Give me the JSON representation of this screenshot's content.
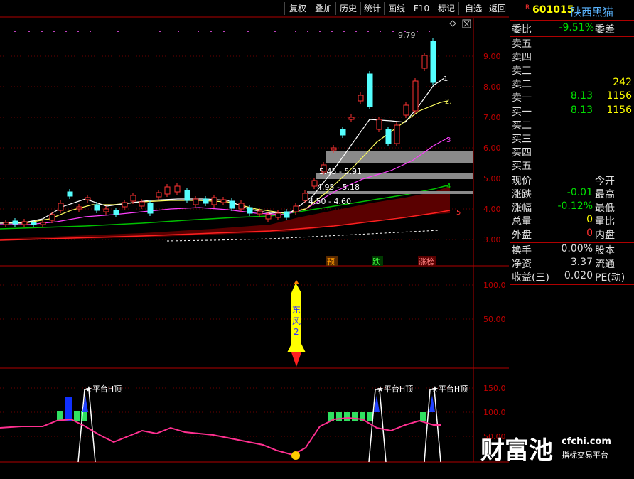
{
  "toolbar": {
    "buttons": [
      "复权",
      "叠加",
      "历史",
      "统计",
      "画线",
      "F10",
      "标记",
      "-自选",
      "返回"
    ],
    "diamond_icon": "diamond-icon",
    "close_icon": "window-close-icon"
  },
  "stock": {
    "r_marker": "R",
    "code": "601015",
    "name": "陕西黑猫"
  },
  "orderbook": {
    "weibi": {
      "label": "委比",
      "value": "-9.51%",
      "label2": "委差"
    },
    "asks": [
      {
        "label": "卖五",
        "price": "",
        "vol": ""
      },
      {
        "label": "卖四",
        "price": "",
        "vol": ""
      },
      {
        "label": "卖三",
        "price": "",
        "vol": ""
      },
      {
        "label": "卖二",
        "price": "",
        "vol": "242"
      },
      {
        "label": "卖一",
        "price": "8.13",
        "vol": "1156"
      }
    ],
    "bids": [
      {
        "label": "买一",
        "price": "8.13",
        "vol": "1156"
      },
      {
        "label": "买二",
        "price": "",
        "vol": ""
      },
      {
        "label": "买三",
        "price": "",
        "vol": ""
      },
      {
        "label": "买四",
        "price": "",
        "vol": ""
      },
      {
        "label": "买五",
        "price": "",
        "vol": ""
      }
    ]
  },
  "stats": [
    {
      "l": "现价",
      "v": "",
      "l2": "今开",
      "color": "#e0e0e0"
    },
    {
      "l": "涨跌",
      "v": "-0.01",
      "l2": "最高",
      "color": "#00e000"
    },
    {
      "l": "涨幅",
      "v": "-0.12%",
      "l2": "最低",
      "color": "#00e000"
    },
    {
      "l": "总量",
      "v": "0",
      "l2": "量比",
      "color": "#ffff00"
    },
    {
      "l": "外盘",
      "v": "0",
      "l2": "内盘",
      "color": "#ff3030"
    }
  ],
  "stats2": [
    {
      "l": "换手",
      "v": "0.00%",
      "l2": "股本"
    },
    {
      "l": "净资",
      "v": "3.37",
      "l2": "流通"
    },
    {
      "l": "收益(三)",
      "v": "0.020",
      "l2": "PE(动)"
    }
  ],
  "main_chart": {
    "y_ticks": [
      "9.00",
      "8.00",
      "7.00",
      "6.00",
      "5.00",
      "4.00",
      "3.00"
    ],
    "high_label": "9.79",
    "ranges": [
      "5.45 - 5.91",
      "4.95 - 5.18",
      "4.50 - 4.60"
    ],
    "line_tags": [
      "1",
      "2.",
      "3",
      "4",
      "5"
    ],
    "markers": [
      "预",
      "跌",
      "涨榜"
    ]
  },
  "mid_chart": {
    "y_ticks": [
      "100.0",
      "50.00"
    ],
    "rocket_text": [
      "东",
      "风",
      "2"
    ]
  },
  "bottom_chart": {
    "y_ticks": [
      "150.0",
      "100.0",
      "50.00"
    ],
    "signal_label": "★平台H顶"
  },
  "watermark": {
    "brand": "财富池",
    "domain": "cfchi.com",
    "tagline": "指标交易平台"
  },
  "colors": {
    "up": "#ff3232",
    "down": "#54ffff",
    "grid": "#7a0000",
    "ma5": "#ffffff",
    "ma10": "#ffff00",
    "ma20": "#ff44ff",
    "ma60": "#00d000"
  }
}
